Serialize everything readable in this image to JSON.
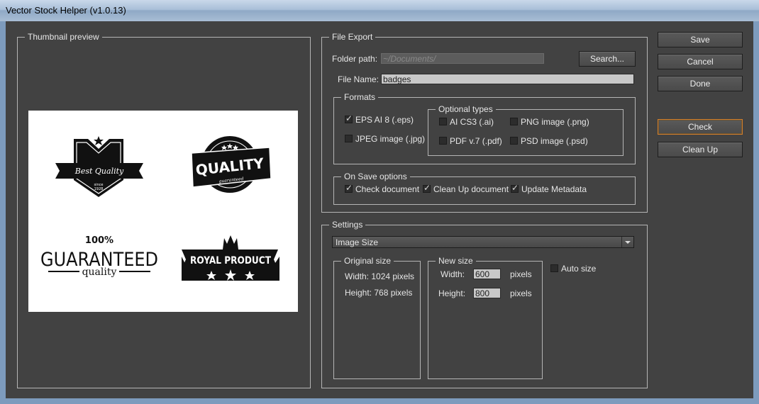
{
  "window": {
    "title": "Vector Stock Helper (v1.0.13)"
  },
  "thumbnail": {
    "legend": "Thumbnail preview",
    "badges": [
      "Best Quality",
      "since",
      "1928",
      "QUALITY",
      "guaranteed",
      "100%",
      "GUARANTEED",
      "quality",
      "ROYAL PRODUCT"
    ]
  },
  "file_export": {
    "legend": "File Export",
    "folder_label": "Folder path:",
    "folder_value": "~/Documents/",
    "search_label": "Search...",
    "filename_label": "File Name:",
    "filename_value": "badges",
    "formats": {
      "legend": "Formats",
      "eps": {
        "label": "EPS AI 8 (.eps)",
        "checked": true
      },
      "jpeg": {
        "label": "JPEG image (.jpg)",
        "checked": false
      },
      "optional": {
        "legend": "Optional types",
        "ai": {
          "label": "AI CS3 (.ai)",
          "checked": false
        },
        "png": {
          "label": "PNG image (.png)",
          "checked": false
        },
        "pdf": {
          "label": "PDF v.7 (.pdf)",
          "checked": false
        },
        "psd": {
          "label": "PSD image (.psd)",
          "checked": false
        }
      }
    },
    "on_save": {
      "legend": "On Save options",
      "check": {
        "label": "Check document",
        "checked": true
      },
      "cleanup": {
        "label": "Clean Up document",
        "checked": true
      },
      "metadata": {
        "label": "Update Metadata",
        "checked": true
      }
    }
  },
  "settings": {
    "legend": "Settings",
    "dropdown_value": "Image Size",
    "original": {
      "legend": "Original size",
      "width": "Width: 1024 pixels",
      "height": "Height: 768 pixels"
    },
    "new_size": {
      "legend": "New size",
      "width_label": "Width:",
      "width_value": "600",
      "height_label": "Height:",
      "height_value": "800",
      "unit": "pixels"
    },
    "auto_size": {
      "label": "Auto size",
      "checked": false
    }
  },
  "buttons": {
    "save": "Save",
    "cancel": "Cancel",
    "done": "Done",
    "check": "Check",
    "cleanup": "Clean Up"
  },
  "colors": {
    "focus": "#d27f2c",
    "panel": "#424242"
  }
}
